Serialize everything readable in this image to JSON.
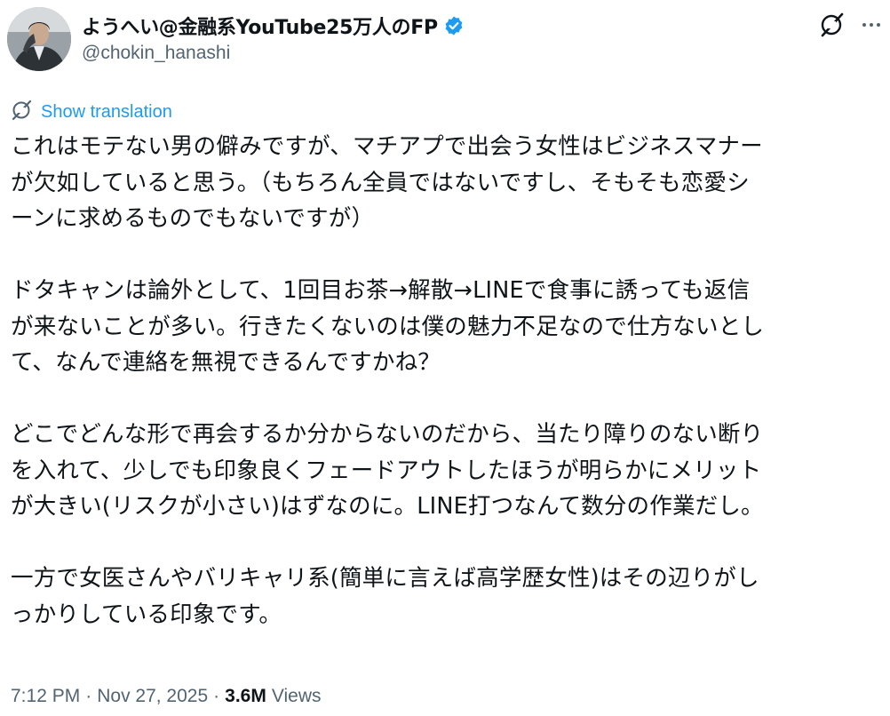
{
  "author": {
    "display_name": "ようへい@金融系YouTube25万人のFP",
    "handle": "@chokin_hanashi",
    "verified": true
  },
  "actions": {
    "grok_icon": "grok-icon",
    "more_icon": "more-horizontal-icon"
  },
  "translate": {
    "label": "Show translation",
    "icon": "grok-icon"
  },
  "tweet": {
    "lines": [
      "これはモテない男の僻みですが、マチアプで出会う女性はビジネスマナー",
      "が欠如していると思う。（もちろん全員ではないですし、そもそも恋愛シ",
      "ーンに求めるものでもないですが）",
      "",
      "ドタキャンは論外として、1回目お茶→解散→LINEで食事に誘っても返信",
      "が来ないことが多い。行きたくないのは僕の魅力不足なので仕方ないとし",
      "て、なんで連絡を無視できるんですかね？",
      "",
      "どこでどんな形で再会するか分からないのだから、当たり障りのない断り",
      "を入れて、少しでも印象良くフェードアウトしたほうが明らかにメリット",
      "が大きい(リスクが小さい)はずなのに。LINE打つなんて数分の作業だし。",
      "",
      "一方で女医さんやバリキャリ系(簡単に言えば高学歴女性)はその辺りがし",
      "っかりしている印象です。"
    ]
  },
  "meta": {
    "time": "7:12 PM",
    "date": "Nov 27, 2025",
    "separator": "·",
    "views_count": "3.6M",
    "views_label": "Views"
  },
  "colors": {
    "text": "#0f1419",
    "secondary": "#536471",
    "link": "#1d9bf0",
    "verified": "#1d9bf0"
  }
}
